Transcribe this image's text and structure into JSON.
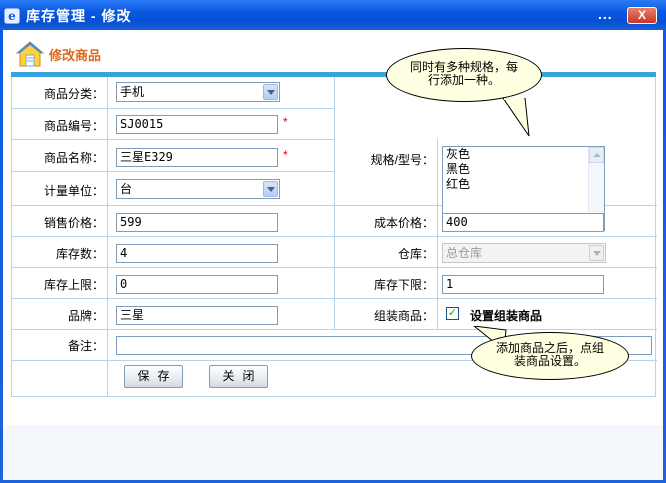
{
  "window": {
    "title": "库存管理 - 修改",
    "menu_dots": "...",
    "close_glyph": "X",
    "app_icon": "e-icon"
  },
  "section": {
    "title": "修改商品",
    "icon": "house-icon"
  },
  "form": {
    "category": {
      "label": "商品分类：",
      "value": "手机"
    },
    "code": {
      "label": "商品编号：",
      "value": "SJ0015",
      "required": "*"
    },
    "name": {
      "label": "商品名称：",
      "value": "三星E329",
      "required": "*"
    },
    "unit": {
      "label": "计量单位：",
      "value": "台"
    },
    "spec": {
      "label": "规格/型号：",
      "items": [
        "灰色",
        "黑色",
        "红色"
      ]
    },
    "sale_price": {
      "label": "销售价格：",
      "value": "599"
    },
    "cost_price": {
      "label": "成本价格：",
      "value": "400"
    },
    "stock": {
      "label": "库存数：",
      "value": "4"
    },
    "warehouse": {
      "label": "仓库：",
      "value": "总仓库"
    },
    "stock_max": {
      "label": "库存上限：",
      "value": "0"
    },
    "stock_min": {
      "label": "库存下限：",
      "value": "1"
    },
    "brand": {
      "label": "品牌：",
      "value": "三星"
    },
    "bundle": {
      "label": "组装商品：",
      "checked": "✓",
      "checkbox_label": "设置组装商品"
    },
    "remark": {
      "label": "备注：",
      "value": ""
    }
  },
  "buttons": {
    "save": "保存",
    "close": "关闭"
  },
  "tooltips": {
    "spec_hint": [
      "同时有多种规格，每",
      "行添加一种。"
    ],
    "bundle_hint": [
      "添加商品之后，点组",
      "装商品设置。"
    ]
  },
  "colors": {
    "titlebar": "#0b57de",
    "accent_bar": "#3aa3dc",
    "section_title": "#e06a1b",
    "required": "#ee0000",
    "tooltip_bg": "#ffffe1"
  }
}
